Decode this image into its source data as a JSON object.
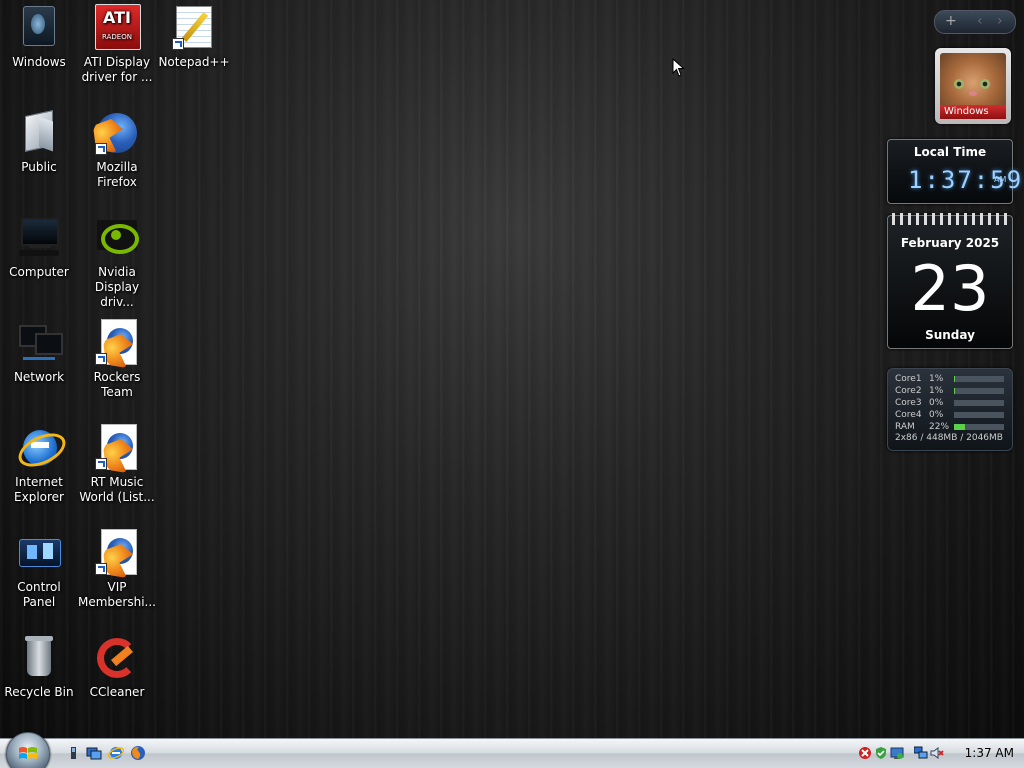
{
  "desktop_icons": [
    {
      "label": "Windows",
      "icon": "windows-user-icon"
    },
    {
      "label": "ATI Display driver for ...",
      "icon": "ati-radeon-icon",
      "badge_text": "ATI",
      "badge_sub": "RADEON"
    },
    {
      "label": "Notepad++",
      "icon": "notepad-plus-plus-icon"
    },
    {
      "label": "Public",
      "icon": "public-folder-icon"
    },
    {
      "label": "Mozilla Firefox",
      "icon": "firefox-icon"
    },
    {
      "label": "Computer",
      "icon": "computer-icon"
    },
    {
      "label": "Nvidia Display driv...",
      "icon": "nvidia-icon"
    },
    {
      "label": "Network",
      "icon": "network-icon"
    },
    {
      "label": "Rockers Team",
      "icon": "firefox-document-icon"
    },
    {
      "label": "Internet Explorer",
      "icon": "internet-explorer-icon"
    },
    {
      "label": "RT Music World (List...",
      "icon": "firefox-document-icon"
    },
    {
      "label": "Control Panel",
      "icon": "control-panel-icon"
    },
    {
      "label": "VIP Membershi...",
      "icon": "firefox-document-icon"
    },
    {
      "label": "Recycle Bin",
      "icon": "recycle-bin-icon"
    },
    {
      "label": "CCleaner",
      "icon": "ccleaner-icon"
    }
  ],
  "gadgets": {
    "toolbar": {
      "add_glyph": "+",
      "prev_glyph": "‹",
      "next_glyph": "›"
    },
    "slideshow": {
      "caption": "Windows"
    },
    "clock": {
      "title": "Local Time",
      "time": "1:37:59",
      "ampm": "AM"
    },
    "calendar": {
      "month_year": "February 2025",
      "day": "23",
      "weekday": "Sunday"
    },
    "cpu_meter": {
      "rows": [
        {
          "name": "Core1",
          "percent": "1%",
          "level": 0.01
        },
        {
          "name": "Core2",
          "percent": "1%",
          "level": 0.01
        },
        {
          "name": "Core3",
          "percent": "0%",
          "level": 0.0
        },
        {
          "name": "Core4",
          "percent": "0%",
          "level": 0.0
        },
        {
          "name": "RAM",
          "percent": "22%",
          "level": 0.22
        }
      ],
      "memory": "2x86 / 448MB / 2046MB"
    }
  },
  "taskbar": {
    "quick_launch": [
      "show-desktop-icon",
      "switch-windows-icon",
      "internet-explorer-icon",
      "firefox-icon"
    ],
    "tray_icons": [
      "security-alert-icon",
      "antivirus-icon",
      "network-status-icon",
      "network-connection-icon",
      "volume-muted-icon"
    ],
    "clock": "1:37 AM"
  },
  "colors": {
    "accent_blue": "#1b5fc4",
    "cpu_bar": "#5ad04c",
    "clock_digits": "#9fd0ff"
  }
}
